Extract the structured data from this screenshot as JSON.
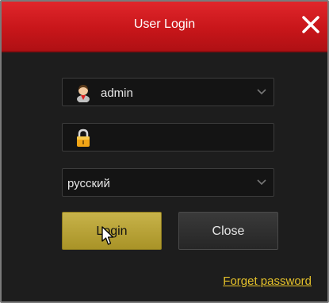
{
  "dialog": {
    "title": "User Login",
    "close_icon": "close-icon"
  },
  "user_field": {
    "value": "admin",
    "icon": "user-avatar-icon"
  },
  "password_field": {
    "value": "",
    "icon": "lock-icon"
  },
  "language_field": {
    "value": "русский"
  },
  "buttons": {
    "login_label": "Login",
    "close_label": "Close"
  },
  "forget_password": "Forget password",
  "colors": {
    "title_bar": "#d41e22",
    "background": "#1d1d1d",
    "login_button": "#b8a236",
    "link": "#e6c22a"
  }
}
